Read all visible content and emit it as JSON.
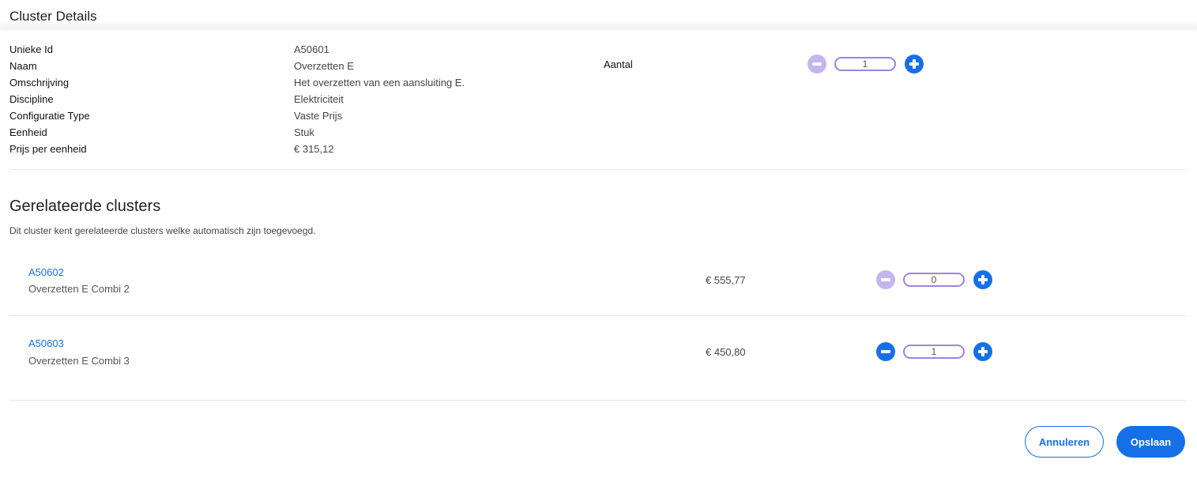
{
  "header": {
    "title": "Cluster Details"
  },
  "details": [
    {
      "label": "Unieke Id",
      "value": "A50601"
    },
    {
      "label": "Naam",
      "value": "Overzetten E"
    },
    {
      "label": "Omschrijving",
      "value": "Het overzetten van een aansluiting E."
    },
    {
      "label": "Discipline",
      "value": "Elektriciteit"
    },
    {
      "label": "Configuratie Type",
      "value": "Vaste Prijs"
    },
    {
      "label": "Eenheid",
      "value": "Stuk"
    },
    {
      "label": "Prijs per eenheid",
      "value": "€ 315,12"
    }
  ],
  "quantity": {
    "label": "Aantal",
    "value": "1",
    "minus_enabled": false
  },
  "related": {
    "title": "Gerelateerde clusters",
    "description": "Dit cluster kent gerelateerde clusters welke automatisch zijn toegevoegd.",
    "items": [
      {
        "id": "A50602",
        "name": "Overzetten E Combi 2",
        "price": "€ 555,77",
        "quantity": "0",
        "minus_enabled": false
      },
      {
        "id": "A50603",
        "name": "Overzetten E Combi 3",
        "price": "€ 450,80",
        "quantity": "1",
        "minus_enabled": true
      }
    ]
  },
  "actions": {
    "cancel_label": "Annuleren",
    "save_label": "Opslaan"
  },
  "colors": {
    "accent": "#1570e8",
    "disabled": "#c5b5ee",
    "stepper_border": "#9b85e0"
  },
  "icons": {
    "minus": "minus-circle-icon",
    "plus": "plus-circle-icon"
  }
}
